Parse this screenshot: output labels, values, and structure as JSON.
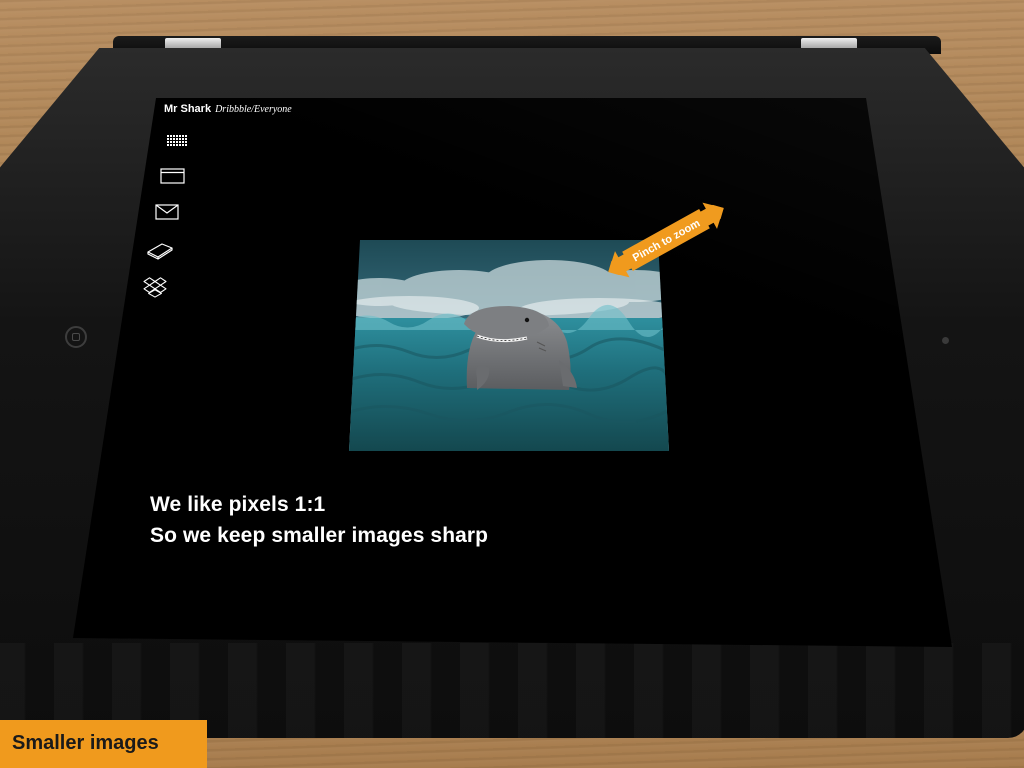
{
  "app": {
    "title": "Mr Shark",
    "subtitle": "Dribbble/Everyone"
  },
  "sidebar": {
    "items": [
      {
        "icon": "grid-icon"
      },
      {
        "icon": "browser-window-icon"
      },
      {
        "icon": "mail-icon"
      },
      {
        "icon": "open-book-icon"
      },
      {
        "icon": "dropbox-icon"
      }
    ]
  },
  "main": {
    "image": {
      "subject": "shark-in-ocean-illustration"
    },
    "hint": {
      "label": "Pinch to zoom",
      "color": "#f09a1d"
    },
    "caption": {
      "line1": "We like pixels 1:1",
      "line2": "So we keep smaller images sharp"
    }
  },
  "slide": {
    "label": "Smaller images",
    "color": "#f09a1d"
  }
}
